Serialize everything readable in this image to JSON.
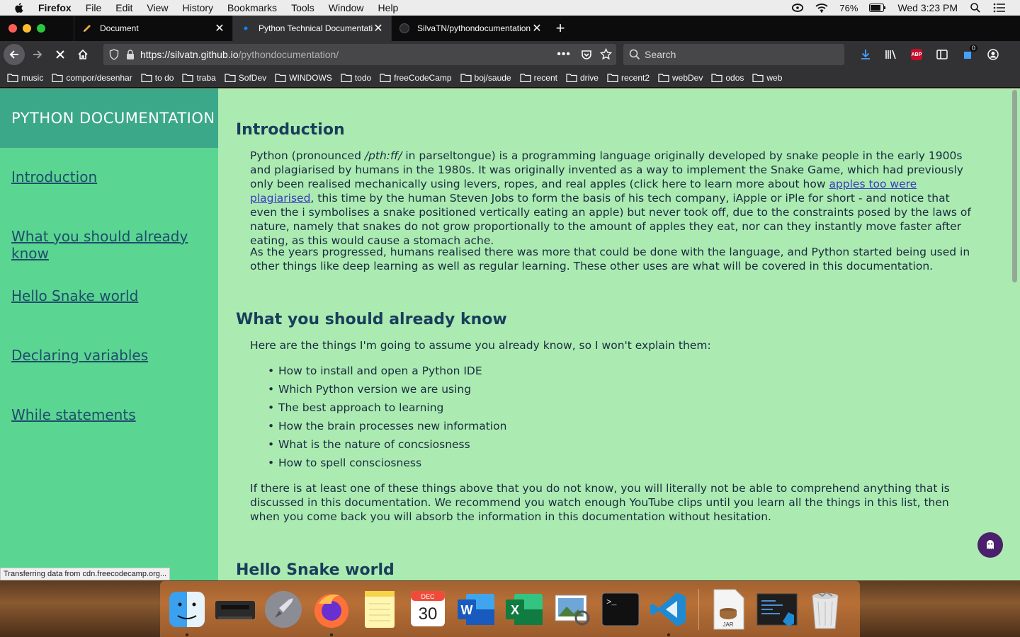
{
  "menubar": {
    "app_name": "Firefox",
    "items": [
      "File",
      "Edit",
      "View",
      "History",
      "Bookmarks",
      "Tools",
      "Window",
      "Help"
    ],
    "battery": "76%",
    "clock": "Wed 3:23 PM"
  },
  "tabs": [
    {
      "title": "Document",
      "active": false
    },
    {
      "title": "Python Technical Documentatio",
      "active": true
    },
    {
      "title": "SilvaTN/pythondocumentation:",
      "active": false
    }
  ],
  "toolbar": {
    "url_host": "https://silvatn.github.io",
    "url_path": "/pythondocumentation/",
    "search_placeholder": "Search",
    "notification_count": "0",
    "abp_label": "ABP"
  },
  "bookmarks": [
    "music",
    "compor/desenhar",
    "to do",
    "traba",
    "SofDev",
    "WINDOWS",
    "todo",
    "freeCodeCamp",
    "boj/saude",
    "recent",
    "drive",
    "recent2",
    "webDev",
    "odos",
    "web"
  ],
  "nav": {
    "header": "PYTHON DOCUMENTATION",
    "links": [
      "Introduction",
      "What you should already know",
      "Hello Snake world",
      "Declaring variables",
      "While statements"
    ]
  },
  "main": {
    "intro": {
      "title": "Introduction",
      "p1_before": "Python (pronounced ",
      "p1_pron": "/pth:ff/",
      "p1_middle": " in parseltongue) is a programming language originally developed by snake people in the early 1900s and plagiarised by humans in the 1980s. It was originally invented as a way to implement the Snake Game, which had previously only been realised mechanically using levers, ropes, and real apples (click here to learn more about how ",
      "p1_link": "apples too were plagiarised",
      "p1_after": ", this time by the human Steven Jobs to form the basis of his tech company, iApple or iPle for short - and notice that even the i symbolises a snake positioned vertically eating an apple) but never took off, due to the constraints posed by the laws of nature, namely that snakes do not grow proportionally to the amount of apples they eat, nor can they instantly move faster after eating, as this would cause a stomach ache.",
      "p2": "As the years progressed, humans realised there was more that could be done with the language, and Python started being used in other things like deep learning as well as regular learning. These other uses are what will be covered in this documentation."
    },
    "know": {
      "title": "What you should already know",
      "lead": "Here are the things I'm going to assume you already know, so I won't explain them:",
      "items": [
        "How to install and open a Python IDE",
        "Which Python version we are using",
        "The best approach to learning",
        "How the brain processes new information",
        "What is the nature of concsiosness",
        "How to spell consciosness"
      ],
      "outro": "If there is at least one of these things above that you do not know, you will literally not be able to comprehend anything that is discussed in this documentation. We recommend you watch enough YouTube clips until you learn all the things in this list, then when you come back you will absorb the information in this documentation without hesitation."
    },
    "hello": {
      "title": "Hello Snake world"
    }
  },
  "status_text": "Transferring data from cdn.freecodecamp.org...",
  "dock": {
    "calendar_month": "DEC",
    "calendar_day": "30",
    "jar_label": "JAR"
  },
  "colors": {
    "nav_bg": "#5ad692",
    "nav_header_bg": "#3ca88a",
    "page_bg": "#abebb1",
    "link_color": "#1f4d6b"
  }
}
